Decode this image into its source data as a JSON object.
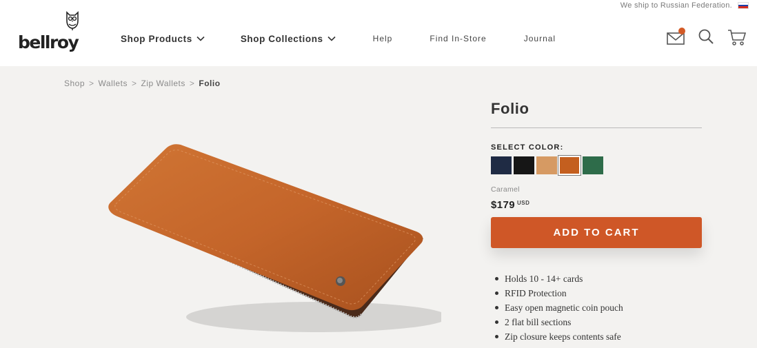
{
  "header": {
    "ship_notice": "We ship to Russian Federation.",
    "logo_text": "bellroy",
    "nav": {
      "shop_products": "Shop Products",
      "shop_collections": "Shop Collections",
      "help": "Help",
      "find_in_store": "Find In-Store",
      "journal": "Journal"
    },
    "icons": [
      "mail-icon",
      "search-icon",
      "cart-icon"
    ],
    "notification_color": "#d35a26"
  },
  "breadcrumb": {
    "items": [
      "Shop",
      "Wallets",
      "Zip Wallets"
    ],
    "separator": ">",
    "current": "Folio"
  },
  "product": {
    "title": "Folio",
    "select_color_label": "SELECT COLOR:",
    "colors": [
      {
        "name": "navy",
        "hex": "#1f2b44"
      },
      {
        "name": "black",
        "hex": "#161616"
      },
      {
        "name": "tan",
        "hex": "#d69a63"
      },
      {
        "name": "caramel",
        "hex": "#c45f1f",
        "selected": true
      },
      {
        "name": "green",
        "hex": "#2e6c4a"
      }
    ],
    "selected_color_name": "Caramel",
    "price": "$179",
    "currency": "USD",
    "add_to_cart_label": "ADD TO CART",
    "add_to_cart_color": "#cf5727",
    "features": [
      "Holds 10 - 14+ cards",
      "RFID Protection",
      "Easy open magnetic coin pouch",
      "2 flat bill sections",
      "Zip closure keeps contents safe"
    ]
  }
}
